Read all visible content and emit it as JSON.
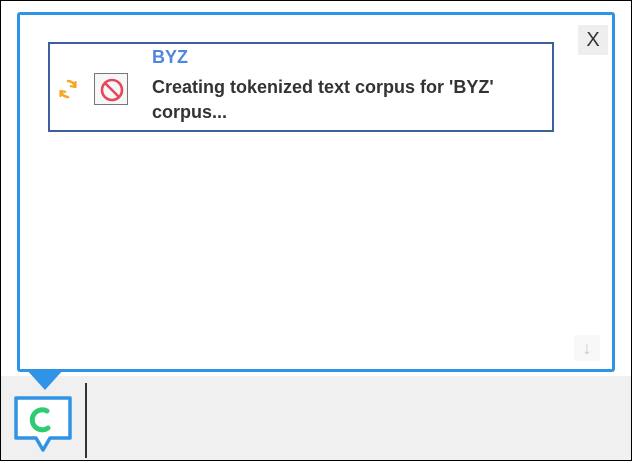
{
  "panel": {
    "close_label": "X",
    "scroll_down_glyph": "↓"
  },
  "task": {
    "title": "BYZ",
    "message": "Creating tokenized text corpus for 'BYZ' corpus...",
    "status_icon": "sync-icon",
    "cancel_icon": "cancel-icon"
  },
  "colors": {
    "accent": "#2f93e6",
    "title": "#4f86e0",
    "sync": "#f5a623",
    "cancel": "#e8475a",
    "spinner": "#2ecc71"
  }
}
